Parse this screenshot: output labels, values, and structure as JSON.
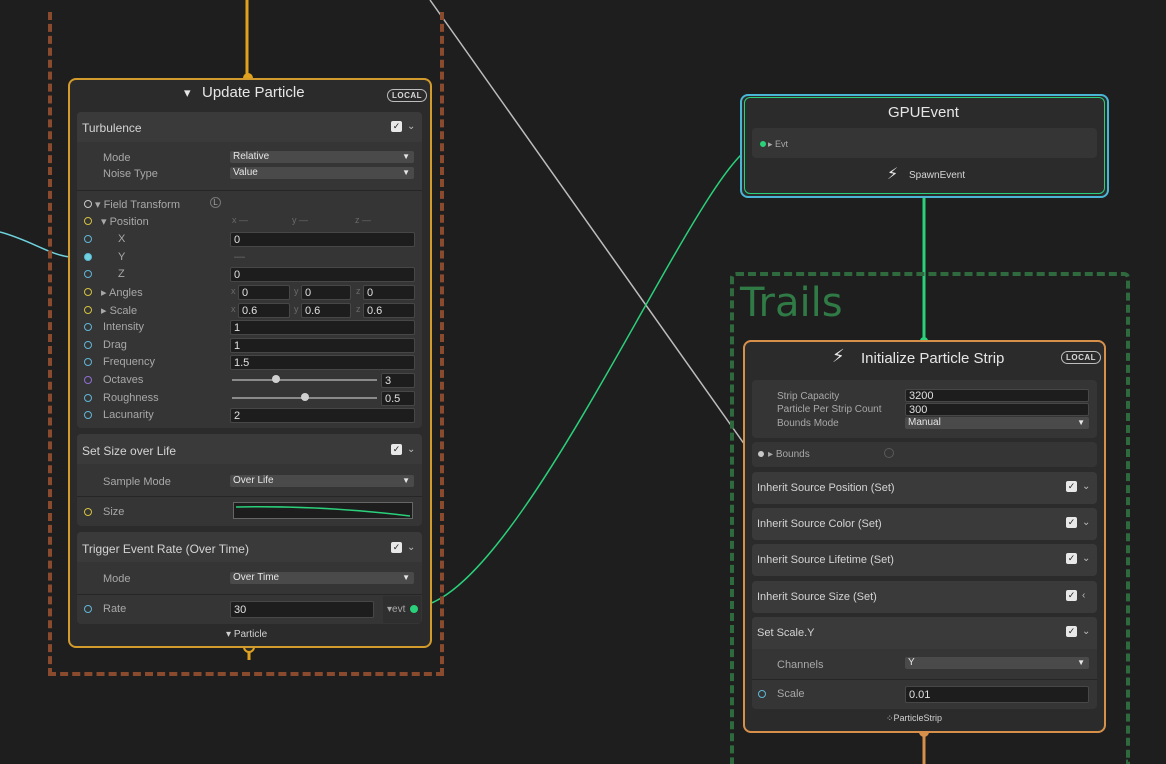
{
  "colors": {
    "flow_orange": "#e0a21e",
    "flow_green": "#2ad07a",
    "property_cyan": "#6fd3de",
    "wire_white": "#bdbdbd",
    "group_rust": "#8a4a2e",
    "group_green": "#2f6a3e"
  },
  "group_trails": {
    "title": "Trails"
  },
  "update_node": {
    "icon": "vfx-update-icon",
    "title": "Update Particle",
    "space_badge": "LOCAL",
    "footer_label": "Particle",
    "turbulence": {
      "title": "Turbulence",
      "mode_label": "Mode",
      "mode_value": "Relative",
      "noise_label": "Noise Type",
      "noise_value": "Value",
      "field_transform_label": "Field Transform",
      "field_transform_badge": "L",
      "position_label": "Position",
      "pos_x_hint": "x —",
      "pos_y_hint": "y —",
      "pos_z_hint": "z —",
      "x_label": "X",
      "x_value": "0",
      "y_label": "Y",
      "y_value": "—",
      "z_label": "Z",
      "z_value": "0",
      "angles_label": "Angles",
      "angles": {
        "x": "0",
        "y": "0",
        "z": "0"
      },
      "scale_label": "Scale",
      "scale": {
        "x": "0.6",
        "y": "0.6",
        "z": "0.6"
      },
      "axis_x": "x",
      "axis_y": "y",
      "axis_z": "z",
      "intensity_label": "Intensity",
      "intensity_value": "1",
      "drag_label": "Drag",
      "drag_value": "1",
      "frequency_label": "Frequency",
      "frequency_value": "1.5",
      "octaves_label": "Octaves",
      "octaves_value": "3",
      "octaves_slider": 0.3,
      "roughness_label": "Roughness",
      "roughness_value": "0.5",
      "roughness_slider": 0.5,
      "lacunarity_label": "Lacunarity",
      "lacunarity_value": "2"
    },
    "size_over_life": {
      "title": "Set Size over Life",
      "sample_mode_label": "Sample Mode",
      "sample_mode_value": "Over Life",
      "size_label": "Size"
    },
    "trigger_event": {
      "title": "Trigger Event Rate (Over Time)",
      "mode_label": "Mode",
      "mode_value": "Over Time",
      "rate_label": "Rate",
      "rate_value": "30",
      "evt_output_label": "evt"
    }
  },
  "gpu_event_node": {
    "title": "GPUEvent",
    "evt_label": "Evt",
    "spawn_label": "SpawnEvent"
  },
  "init_node": {
    "icon": "lightning-icon",
    "title": "Initialize Particle Strip",
    "space_badge": "LOCAL",
    "strip_capacity_label": "Strip Capacity",
    "strip_capacity_value": "3200",
    "particle_per_strip_label": "Particle Per Strip Count",
    "particle_per_strip_value": "300",
    "bounds_mode_label": "Bounds Mode",
    "bounds_mode_value": "Manual",
    "bounds_label": "Bounds",
    "blocks": [
      "Inherit Source Position (Set)",
      "Inherit Source Color (Set)",
      "Inherit Source Lifetime (Set)",
      "Inherit Source Size (Set)"
    ],
    "set_scale": {
      "title": "Set Scale.Y",
      "channels_label": "Channels",
      "channels_value": "Y",
      "scale_label": "Scale",
      "scale_value": "0.01"
    },
    "footer_label": "ParticleStrip"
  }
}
